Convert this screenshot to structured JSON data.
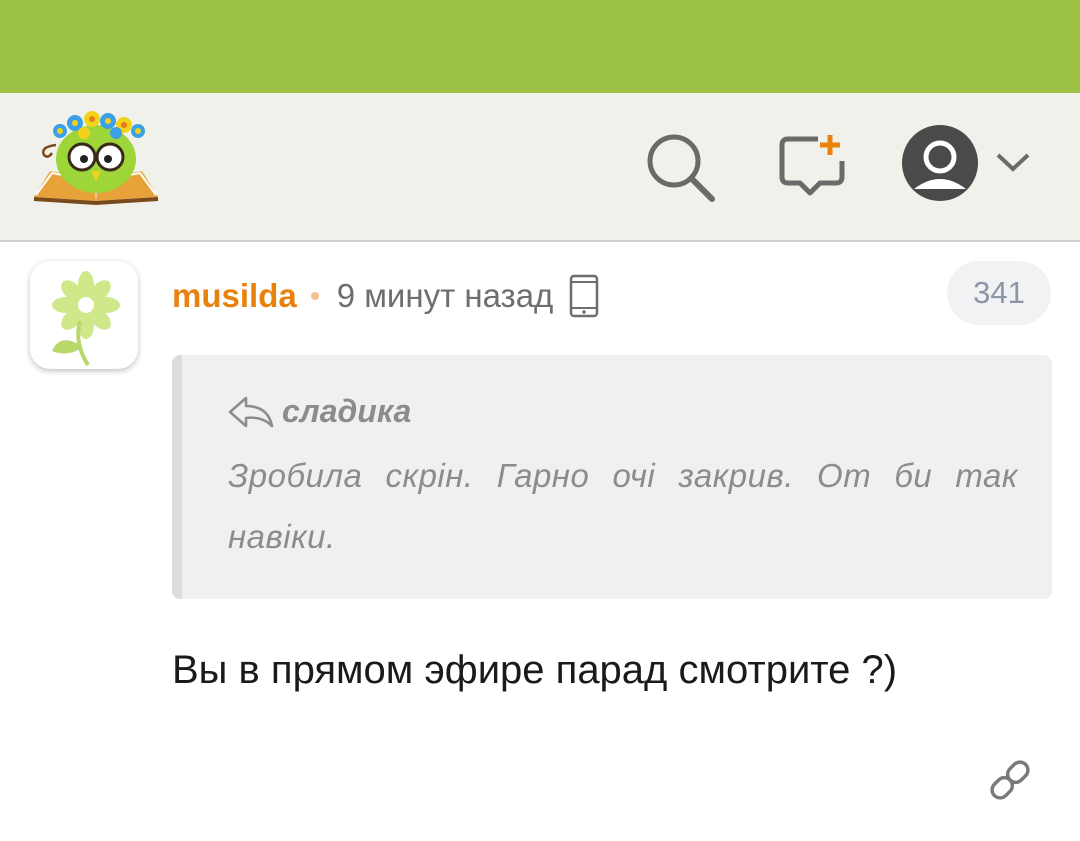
{
  "header": {
    "logo": "reading-owl-logo",
    "icons": [
      "search-icon",
      "add-comment-icon",
      "user-avatar-icon",
      "chevron-down-icon"
    ],
    "colors": {
      "topbar": "#9cc144",
      "header_bg": "#f1f1ec"
    }
  },
  "comment": {
    "author": "musilda",
    "time": "9 минут назад",
    "device_icon": "mobile-phone-icon",
    "count": "341",
    "quote": {
      "author": "сладика",
      "text": "Зробила скрін. Гарно очі закрив. От би так навіки."
    },
    "text": "Вы в прямом эфире парад смотрите ?)",
    "author_color": "#e8820c"
  }
}
